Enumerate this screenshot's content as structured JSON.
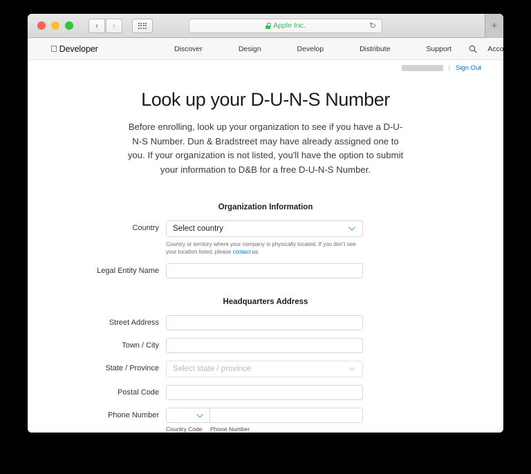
{
  "browser": {
    "address_bar": {
      "value": "Apple Inc.",
      "lock_icon": "green-lock-icon",
      "reload_icon": "reload-icon"
    },
    "back_label": "‹",
    "forward_label": "›",
    "sidebar_icon": "grid-icon",
    "new_tab_label": "+"
  },
  "site_nav": {
    "brand": {
      "logo": "apple-logo",
      "name": "Developer"
    },
    "links": [
      {
        "label": "Discover"
      },
      {
        "label": "Design"
      },
      {
        "label": "Develop"
      },
      {
        "label": "Distribute"
      },
      {
        "label": "Support"
      },
      {
        "label": "Account"
      }
    ],
    "search_icon": "search-icon"
  },
  "account_bar": {
    "username_redacted": "redacted",
    "divider": "|",
    "sign_out_label": "Sign Out",
    "link_color": "#0070c9"
  },
  "page": {
    "title": "Look up your D-U-N-S Number",
    "intro": "Before enrolling, look up your organization to see if you have a D-U-N-S Number. Dun & Bradstreet may have already assigned one to you. If your organization is not listed, you'll have the option to submit your information to D&B for a free D-U-N-S Number."
  },
  "form": {
    "organization_section": {
      "heading": "Organization Information",
      "country": {
        "label": "Country",
        "value": "Select country",
        "chevron_icon": "chevron-down-icon",
        "chevron_color": "#5ab4f0",
        "help_text_before": "Country or territory where your company is physically located. If you don't see your location listed, please ",
        "help_link": "contact us",
        "help_text_after": "."
      },
      "legal_entity_name": {
        "label": "Legal Entity Name",
        "value": "",
        "placeholder": ""
      }
    },
    "headquarters_section": {
      "heading": "Headquarters Address",
      "street_address": {
        "label": "Street Address",
        "value": "",
        "placeholder": ""
      },
      "town_city": {
        "label": "Town / City",
        "value": "",
        "placeholder": ""
      },
      "state_province": {
        "label": "State / Province",
        "value": "Select state / province",
        "disabled": true,
        "chevron_icon": "chevron-down-icon",
        "chevron_color": "#d2d2d2"
      },
      "postal_code": {
        "label": "Postal Code",
        "value": "",
        "placeholder": ""
      },
      "phone_number": {
        "label": "Phone Number",
        "country_code_value": "",
        "country_code_chevron_color": "#5ab4f0",
        "number_value": "",
        "sub_label_country_code": "Country Code",
        "sub_label_phone_number": "Phone Number"
      }
    }
  }
}
